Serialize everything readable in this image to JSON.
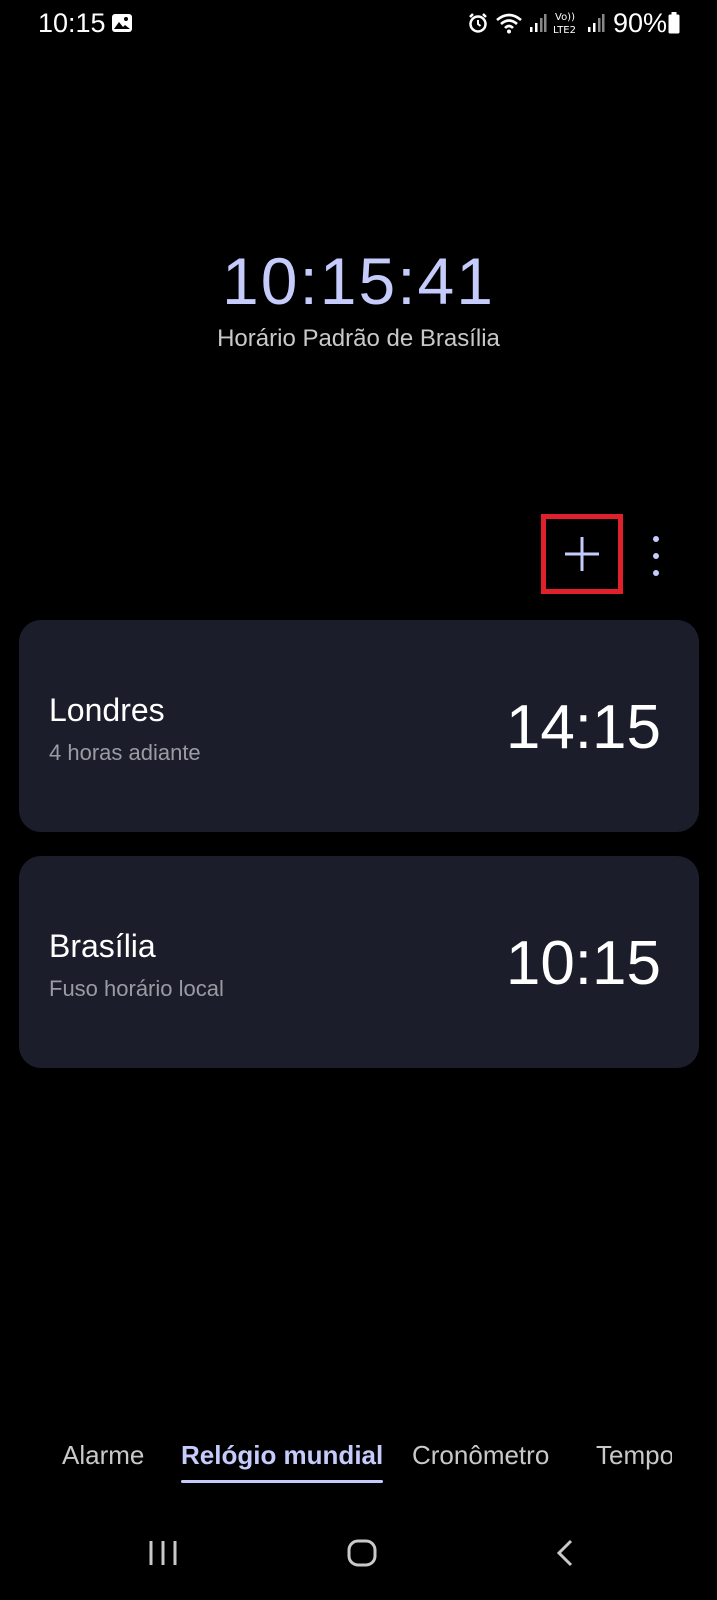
{
  "status_bar": {
    "time": "10:15",
    "battery": "90%",
    "network_label": "Vo)) LTE2",
    "icons": [
      "gallery-icon",
      "alarm-icon",
      "wifi-icon",
      "signal-icon",
      "volte-icon",
      "signal-icon",
      "battery-icon"
    ]
  },
  "main_clock": {
    "time": "10:15:41",
    "zone": "Horário Padrão de Brasília"
  },
  "actions": {
    "add_icon": "plus-icon",
    "more_icon": "more-vertical-icon",
    "highlight_color": "#e0212b"
  },
  "cities": [
    {
      "name": "Londres",
      "sub": "4 horas adiante",
      "time": "14:15"
    },
    {
      "name": "Brasília",
      "sub": "Fuso horário local",
      "time": "10:15"
    }
  ],
  "tabs": {
    "items": [
      "Alarme",
      "Relógio mundial",
      "Cronômetro",
      "Tempo"
    ],
    "active": "Relógio mundial"
  },
  "colors": {
    "accent": "#c5cbfb",
    "card_bg": "#1b1d2a",
    "background": "#000000"
  }
}
